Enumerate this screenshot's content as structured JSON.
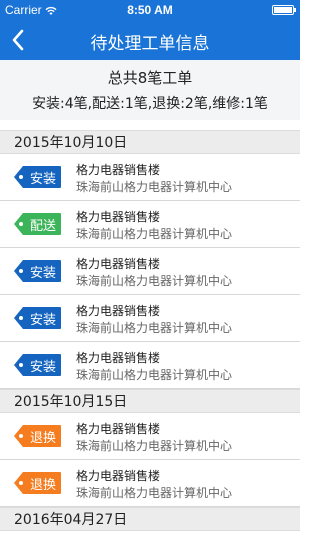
{
  "status_bar": {
    "carrier": "Carrier",
    "time": "8:50 AM"
  },
  "nav": {
    "title": "待处理工单信息"
  },
  "summary": {
    "total": "总共8笔工单",
    "breakdown": "安装:4笔,配送:1笔,退换:2笔,维修:1笔"
  },
  "colors": {
    "install": "#1565c0",
    "delivery": "#3cb55a",
    "return": "#f57c1f",
    "header_blue": "#1a73d6"
  },
  "groups": [
    {
      "date": "2015年10月10日",
      "items": [
        {
          "type": "安装",
          "type_key": "install",
          "name": "格力电器销售楼",
          "address": "珠海前山格力电器计算机中心"
        },
        {
          "type": "配送",
          "type_key": "delivery",
          "name": "格力电器销售楼",
          "address": "珠海前山格力电器计算机中心"
        },
        {
          "type": "安装",
          "type_key": "install",
          "name": "格力电器销售楼",
          "address": "珠海前山格力电器计算机中心"
        },
        {
          "type": "安装",
          "type_key": "install",
          "name": "格力电器销售楼",
          "address": "珠海前山格力电器计算机中心"
        },
        {
          "type": "安装",
          "type_key": "install",
          "name": "格力电器销售楼",
          "address": "珠海前山格力电器计算机中心"
        }
      ]
    },
    {
      "date": "2015年10月15日",
      "items": [
        {
          "type": "退换",
          "type_key": "return",
          "name": "格力电器销售楼",
          "address": "珠海前山格力电器计算机中心"
        },
        {
          "type": "退换",
          "type_key": "return",
          "name": "格力电器销售楼",
          "address": "珠海前山格力电器计算机中心"
        }
      ]
    },
    {
      "date": "2016年04月27日",
      "items": []
    }
  ]
}
